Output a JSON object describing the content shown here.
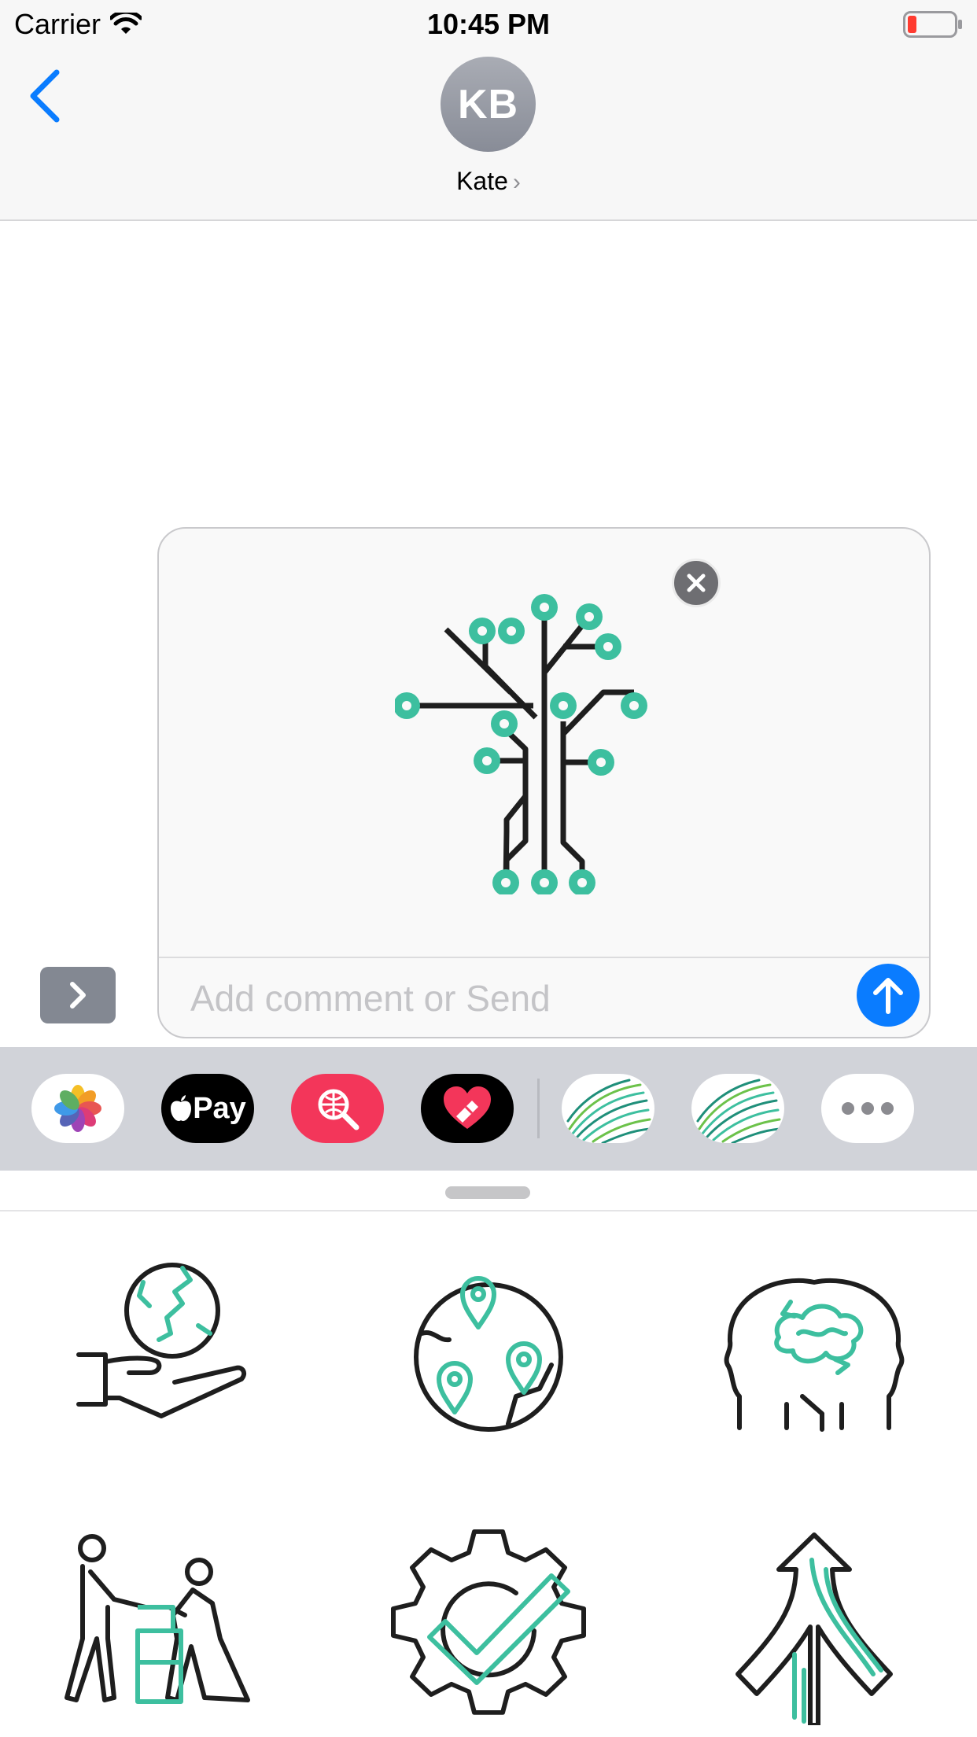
{
  "status_bar": {
    "carrier": "Carrier",
    "time": "10:45 PM"
  },
  "header": {
    "avatar_initials": "KB",
    "contact_name": "Kate"
  },
  "compose": {
    "placeholder": "Add comment or Send",
    "attachment": "circuit-tree-sticker"
  },
  "app_drawer": {
    "apps": [
      {
        "name": "photos-icon"
      },
      {
        "name": "apple-pay-icon",
        "label": "Pay"
      },
      {
        "name": "search-globe-icon"
      },
      {
        "name": "heart-app-icon"
      },
      {
        "name": "fingerprint-sticker-app-icon"
      },
      {
        "name": "fingerprint-sticker-app-icon"
      },
      {
        "name": "more-icon"
      }
    ]
  },
  "stickers": [
    "hand-holding-globe-sticker",
    "globe-location-pins-sticker",
    "two-heads-brain-sticker",
    "people-moving-boxes-sticker",
    "gear-checkmark-sticker",
    "merging-arrows-sticker"
  ],
  "colors": {
    "accent": "#0a7cff",
    "sticker_teal": "#3dbf9f",
    "sticker_dark": "#1e1e1e"
  }
}
